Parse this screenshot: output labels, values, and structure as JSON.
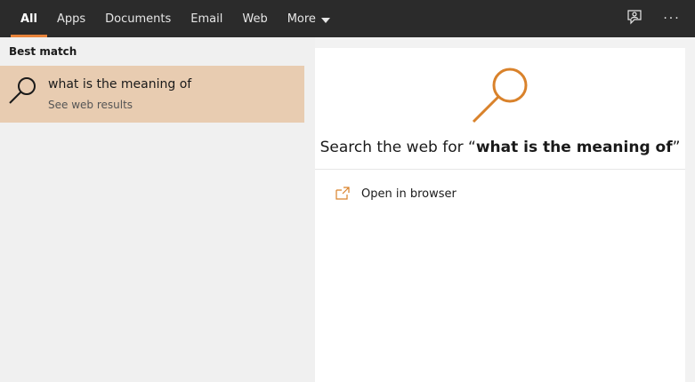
{
  "tabs": [
    {
      "label": "All",
      "active": true
    },
    {
      "label": "Apps"
    },
    {
      "label": "Documents"
    },
    {
      "label": "Email"
    },
    {
      "label": "Web"
    },
    {
      "label": "More"
    }
  ],
  "topbar": {
    "feedback_icon": "feedback-icon",
    "more_options": "···"
  },
  "left": {
    "section_title": "Best match",
    "result": {
      "title": "what is the meaning of",
      "subtitle": "See web results",
      "icon": "search-icon"
    }
  },
  "right": {
    "search_prefix": "Search the web for “",
    "query": "what is the meaning of",
    "search_suffix": "”",
    "actions": [
      {
        "label": "Open in browser",
        "icon": "open-in-browser-icon"
      }
    ]
  },
  "colors": {
    "accent": "#e8833a",
    "selected_bg": "#e8ccb1",
    "topbar_bg": "#2b2b2b"
  }
}
